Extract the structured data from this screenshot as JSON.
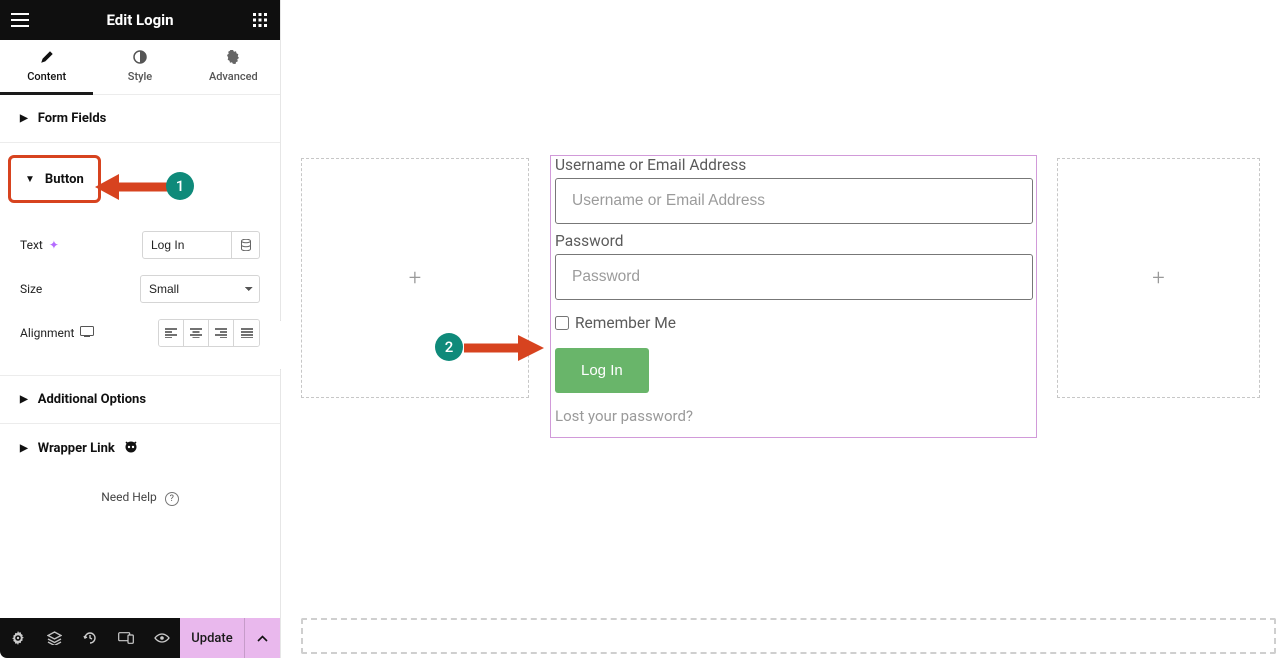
{
  "brand": {
    "accent": "#0f8a7a"
  },
  "header": {
    "title": "Edit Login"
  },
  "tabs": {
    "content": "Content",
    "style": "Style",
    "advanced": "Advanced"
  },
  "sections": {
    "form_fields": "Form Fields",
    "button": "Button",
    "additional_options": "Additional Options",
    "wrapper_link": "Wrapper Link"
  },
  "button_panel": {
    "text_label": "Text",
    "text_value": "Log In",
    "size_label": "Size",
    "size_value": "Small",
    "alignment_label": "Alignment"
  },
  "help": {
    "label": "Need Help"
  },
  "footer": {
    "update": "Update"
  },
  "canvas": {
    "form": {
      "username_label": "Username or Email Address",
      "username_placeholder": "Username or Email Address",
      "password_label": "Password",
      "password_placeholder": "Password",
      "remember": "Remember Me",
      "login_button": "Log In",
      "lost_password": "Lost your password?"
    }
  },
  "annotations": {
    "one": "1",
    "two": "2"
  }
}
